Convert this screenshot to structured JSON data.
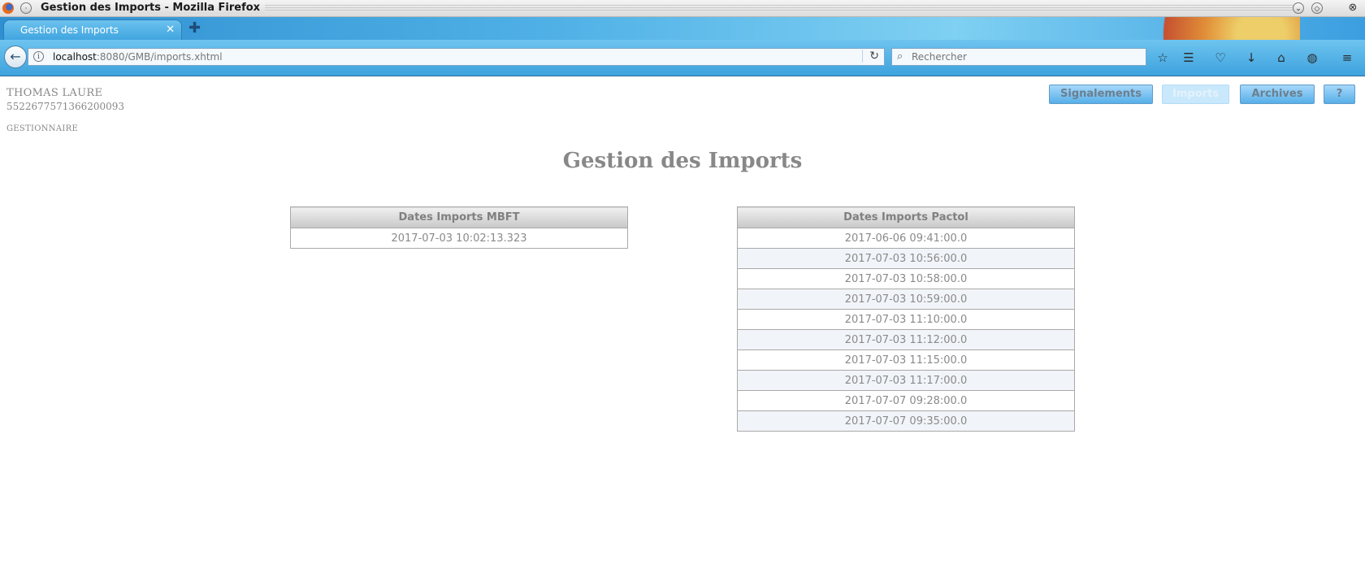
{
  "window": {
    "title": "Gestion des Imports - Mozilla Firefox"
  },
  "browser": {
    "tab_label": "Gestion des Imports",
    "url_host": "localhost",
    "url_path": ":8080/GMB/imports.xhtml",
    "search_placeholder": "Rechercher"
  },
  "user": {
    "name": "THOMAS LAURE",
    "id": "5522677571366200093",
    "role": "GESTIONNAIRE"
  },
  "nav": {
    "signalements": "Signalements",
    "imports": "Imports",
    "archives": "Archives",
    "help": "?"
  },
  "page": {
    "title": "Gestion des Imports"
  },
  "table_mbft": {
    "header": "Dates Imports MBFT",
    "rows": [
      "2017-07-03 10:02:13.323"
    ]
  },
  "table_pactol": {
    "header": "Dates Imports Pactol",
    "rows": [
      "2017-06-06 09:41:00.0",
      "2017-07-03 10:56:00.0",
      "2017-07-03 10:58:00.0",
      "2017-07-03 10:59:00.0",
      "2017-07-03 11:10:00.0",
      "2017-07-03 11:12:00.0",
      "2017-07-03 11:15:00.0",
      "2017-07-03 11:17:00.0",
      "2017-07-07 09:28:00.0",
      "2017-07-07 09:35:00.0"
    ]
  },
  "colors": {
    "button_gradient_top": "#a6d8fb",
    "button_gradient_bottom": "#57afe8",
    "text_gray": "#888888",
    "row_alt": "#f1f4f8"
  }
}
